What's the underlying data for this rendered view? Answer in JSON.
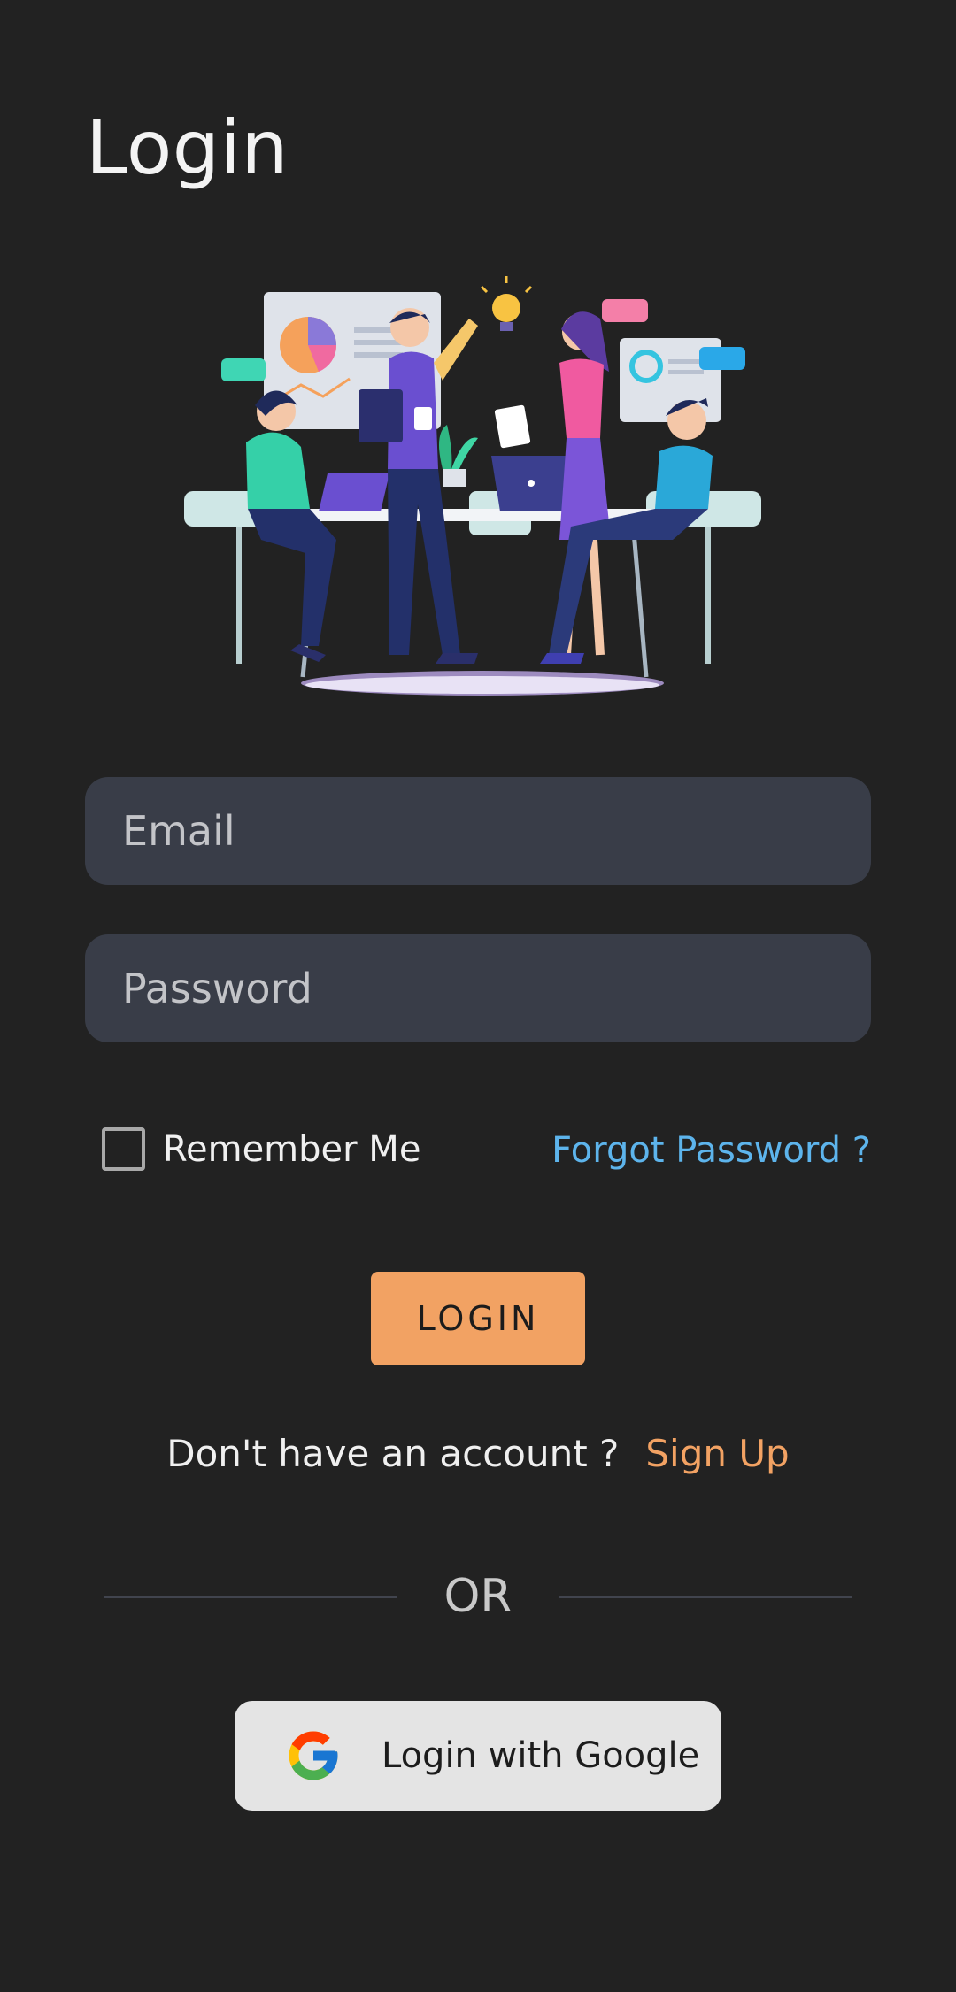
{
  "header": {
    "title": "Login"
  },
  "form": {
    "email_placeholder": "Email",
    "password_placeholder": "Password",
    "remember_label": "Remember Me",
    "forgot_label": "Forgot Password ?",
    "login_button": "LOGIN"
  },
  "signup": {
    "prompt": "Don't have an account ?",
    "link": "Sign Up"
  },
  "divider": {
    "label": "OR"
  },
  "google": {
    "label": "Login with Google",
    "icon": "google-logo-icon"
  },
  "colors": {
    "background": "#222222",
    "field_bg": "#393d48",
    "accent_orange": "#f2a263",
    "link_blue": "#5db4ec",
    "google_btn_bg": "#e4e4e4"
  }
}
